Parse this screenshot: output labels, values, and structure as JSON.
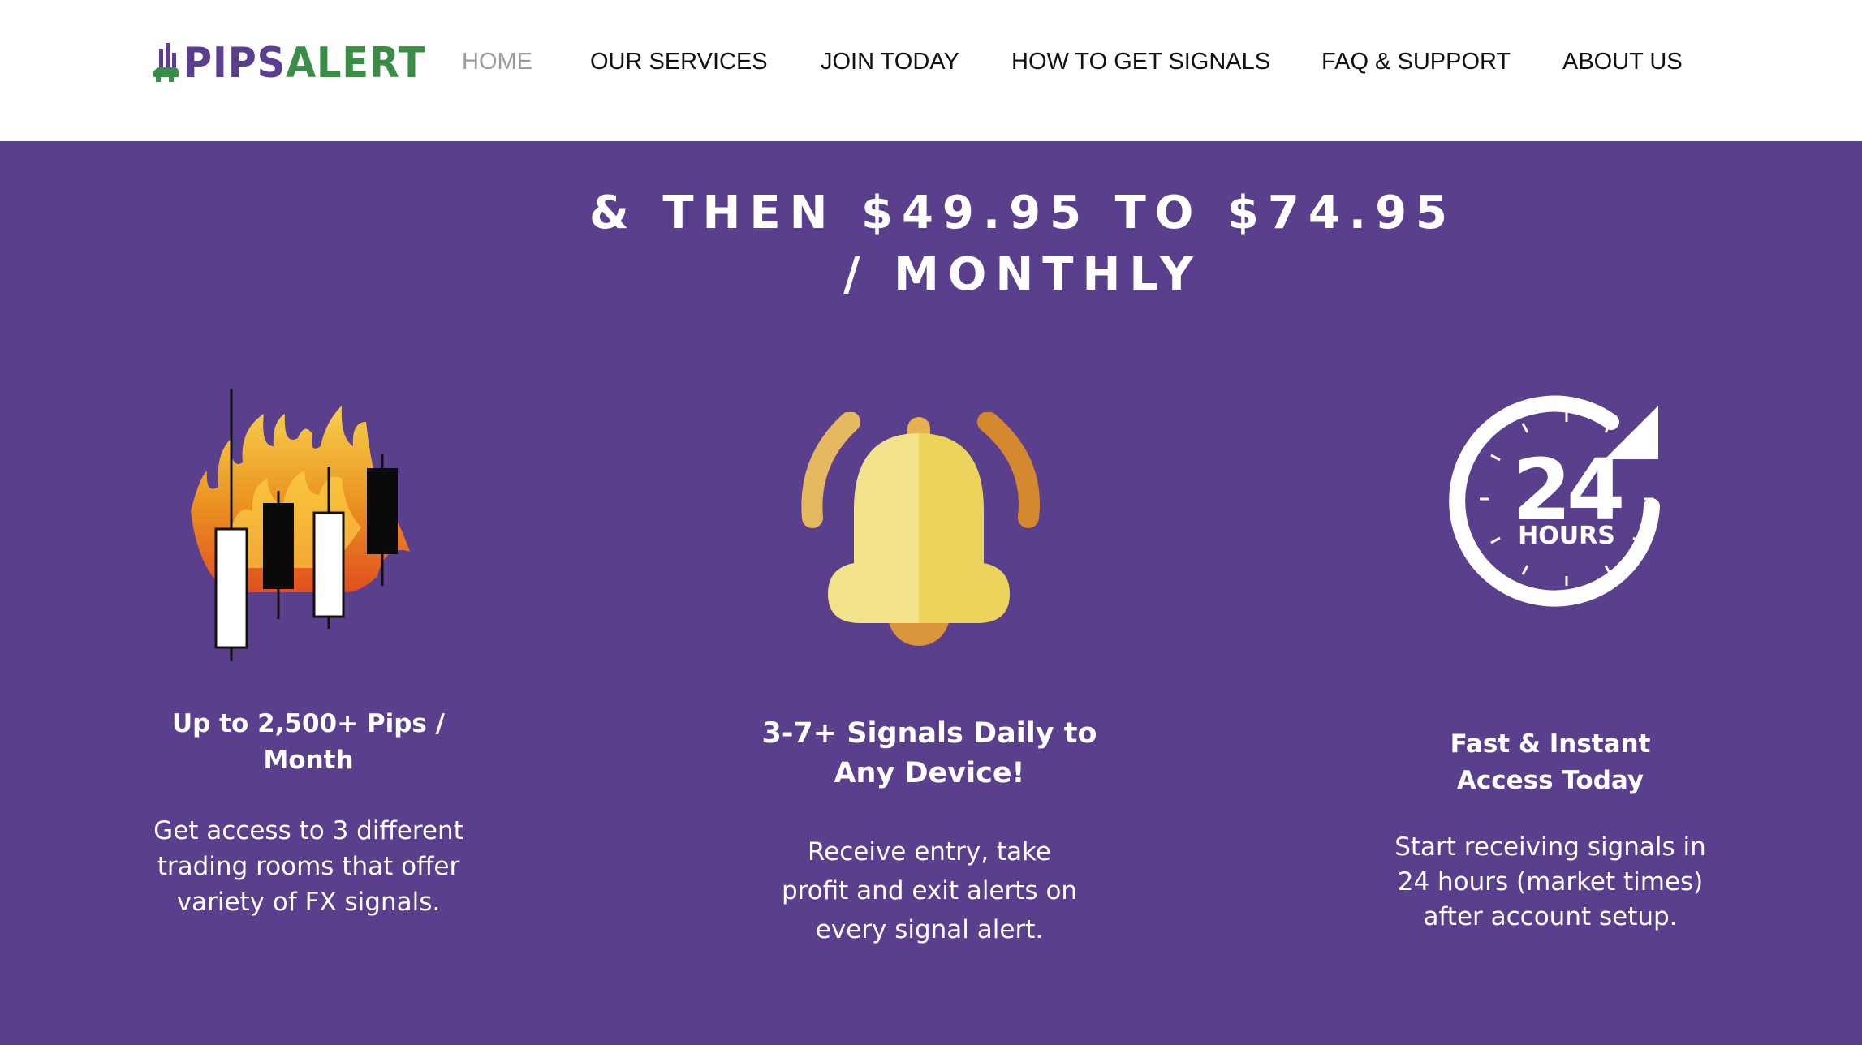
{
  "header": {
    "logo": {
      "part1": "PIPS",
      "part2": "ALERT"
    },
    "nav": [
      {
        "label": "HOME",
        "active": true
      },
      {
        "label": "OUR SERVICES",
        "active": false
      },
      {
        "label": "JOIN TODAY",
        "active": false
      },
      {
        "label": "HOW TO GET SIGNALS",
        "active": false
      },
      {
        "label": "FAQ & SUPPORT",
        "active": false
      },
      {
        "label": "ABOUT US",
        "active": false
      }
    ]
  },
  "hero": {
    "price_line1": "& THEN $49.95 TO $74.95",
    "price_line2": "/ MONTHLY"
  },
  "features": [
    {
      "icon": "flaming-candlestick-icon",
      "title_line1": "Up to 2,500+ Pips /",
      "title_line2": "Month",
      "text_line1": "Get access to 3 different",
      "text_line2": "trading rooms that offer",
      "text_line3": "variety of FX signals."
    },
    {
      "icon": "bell-icon",
      "title_line1": "3-7+ Signals Daily to",
      "title_line2": "Any Device!",
      "text_line1": "Receive entry, take",
      "text_line2": "profit and exit alerts on",
      "text_line3": "every signal alert."
    },
    {
      "icon": "24-hours-icon",
      "icon_number": "24",
      "icon_label": "HOURS",
      "title_line1": "Fast & Instant",
      "title_line2": "Access Today",
      "text_line1": "Start receiving signals in",
      "text_line2": "24 hours (market times)",
      "text_line3": "after account setup."
    }
  ],
  "colors": {
    "background": "#5a3f8d",
    "brand_purple": "#5b3f8e",
    "brand_green": "#3a8c47",
    "bell_light": "#f2e38a",
    "bell_dark": "#ecd45c",
    "bell_orange": "#d9963a"
  }
}
